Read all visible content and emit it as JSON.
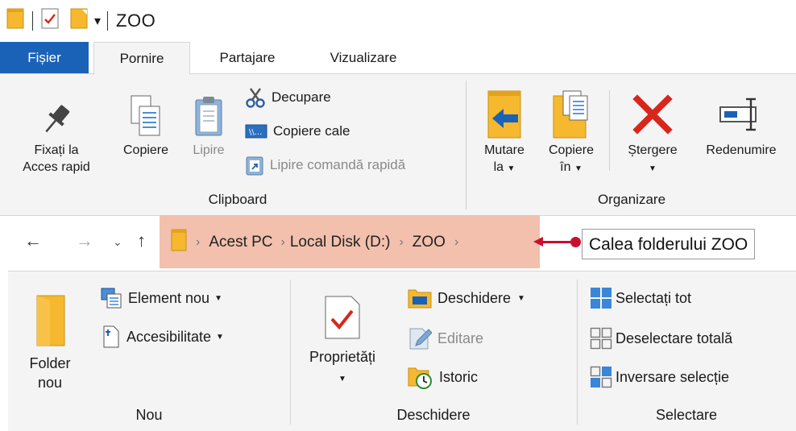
{
  "window": {
    "title": "ZOO"
  },
  "tabs": {
    "file": "Fișier",
    "home": "Pornire",
    "share": "Partajare",
    "view": "Vizualizare"
  },
  "clipboard": {
    "pin": [
      "Fixați la",
      "Acces rapid"
    ],
    "copy": "Copiere",
    "paste": "Lipire",
    "cut": "Decupare",
    "copy_path": "Copiere cale",
    "paste_shortcut": "Lipire comandă rapidă",
    "label": "Clipboard"
  },
  "organize": {
    "move": [
      "Mutare",
      "la"
    ],
    "copy_to": [
      "Copiere",
      "în"
    ],
    "delete": "Ștergere",
    "rename": "Redenumire",
    "label": "Organizare"
  },
  "address": {
    "segments": [
      "Acest PC",
      "Local Disk (D:)",
      "ZOO"
    ],
    "callout": "Calea folderului ZOO"
  },
  "new_group": {
    "new_folder": [
      "Folder",
      "nou"
    ],
    "new_item": "Element nou",
    "easy_access": "Accesibilitate",
    "label": "Nou"
  },
  "open_group": {
    "properties": "Proprietăți",
    "open": "Deschidere",
    "edit": "Editare",
    "history": "Istoric",
    "label": "Deschidere"
  },
  "select_group": {
    "select_all": "Selectați tot",
    "select_none": "Deselectare totală",
    "invert": "Inversare selecție",
    "label": "Selectare"
  },
  "colors": {
    "accent": "#1a62b8",
    "folder": "#f5b82e",
    "delete": "#d9261c",
    "callout": "#c8102e",
    "highlight": "#f2c0ad"
  }
}
